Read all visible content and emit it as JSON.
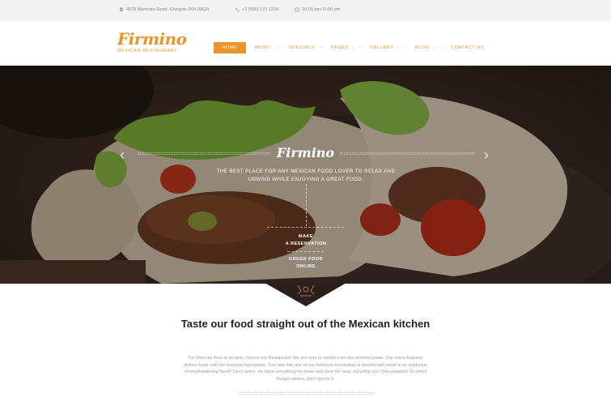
{
  "topbar": {
    "address": "4578 Marmora Road, Glasgow D04 89GR",
    "phone": "+1 (800) 123 1234",
    "hours": "10:00 am-11:00 pm",
    "icons": [
      "map-pin-icon",
      "phone-icon",
      "clock-icon"
    ]
  },
  "header": {
    "logo_name": "Firmino",
    "logo_tagline": "MEXICAN RESTAURANT",
    "nav": [
      {
        "label": "HOME",
        "active": true
      },
      {
        "label": "MENU"
      },
      {
        "label": "SPECIALS"
      },
      {
        "label": "PAGES",
        "dropdown": true
      },
      {
        "label": "GALLERY",
        "dropdown": true
      },
      {
        "label": "BLOG",
        "dropdown": true
      },
      {
        "label": "CONTACT US"
      }
    ]
  },
  "hero": {
    "title": "Firmino",
    "subtitle": "THE BEST PLACE FOR ANY MEXICAN FOOD LOVER TO RELAX AND UNWIND WHILE ENJOYING A GREAT FOOD.",
    "cta_reservation": "MAKE\nA RESERVATION",
    "cta_order": "ORDER FOOD\nONLINE",
    "prev_arrow": "‹",
    "next_arrow": "›"
  },
  "content": {
    "heading": "Taste our food straight out of the Mexican kitchen",
    "paragraph": "For Mexican food at its best, choose our Restaurant! We are sure to satisfy even the pickiest palate. Our menu features dishes made with the freshest ingredients. One bite into one of our delicious enchiladas or burritos will result in an explosion of mouthwatering flavor! Don't worry: we have something for those who love the heat, including our Chile peppers! So when hunger strikes, don't ignore it."
  },
  "colors": {
    "accent": "#e7962a",
    "topbar_bg": "#f3f3f3",
    "emblem_bg": "#2a1f1a"
  }
}
